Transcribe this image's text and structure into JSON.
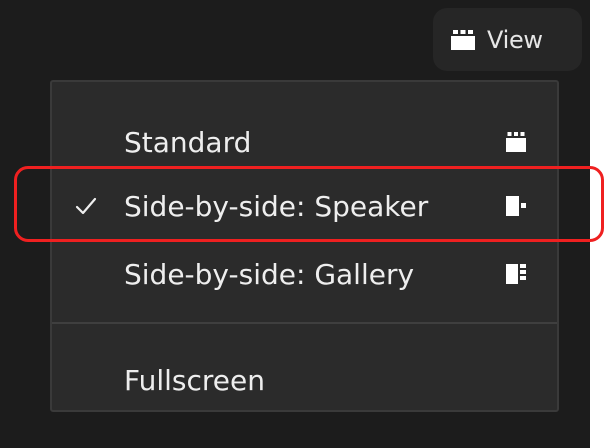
{
  "view_button": {
    "label": "View",
    "icon": "gallery-view-icon"
  },
  "menu": {
    "items": [
      {
        "label": "Standard",
        "icon": "standard-view-icon",
        "checked": false
      },
      {
        "label": "Side-by-side: Speaker",
        "icon": "speaker-view-icon",
        "checked": true
      },
      {
        "label": "Side-by-side: Gallery",
        "icon": "gallery-side-icon",
        "checked": false
      }
    ],
    "fullscreen_label": "Fullscreen"
  },
  "colors": {
    "background": "#1c1c1c",
    "menu_background": "#2b2b2b",
    "text": "#eeeeee",
    "highlight": "#ef2020"
  }
}
